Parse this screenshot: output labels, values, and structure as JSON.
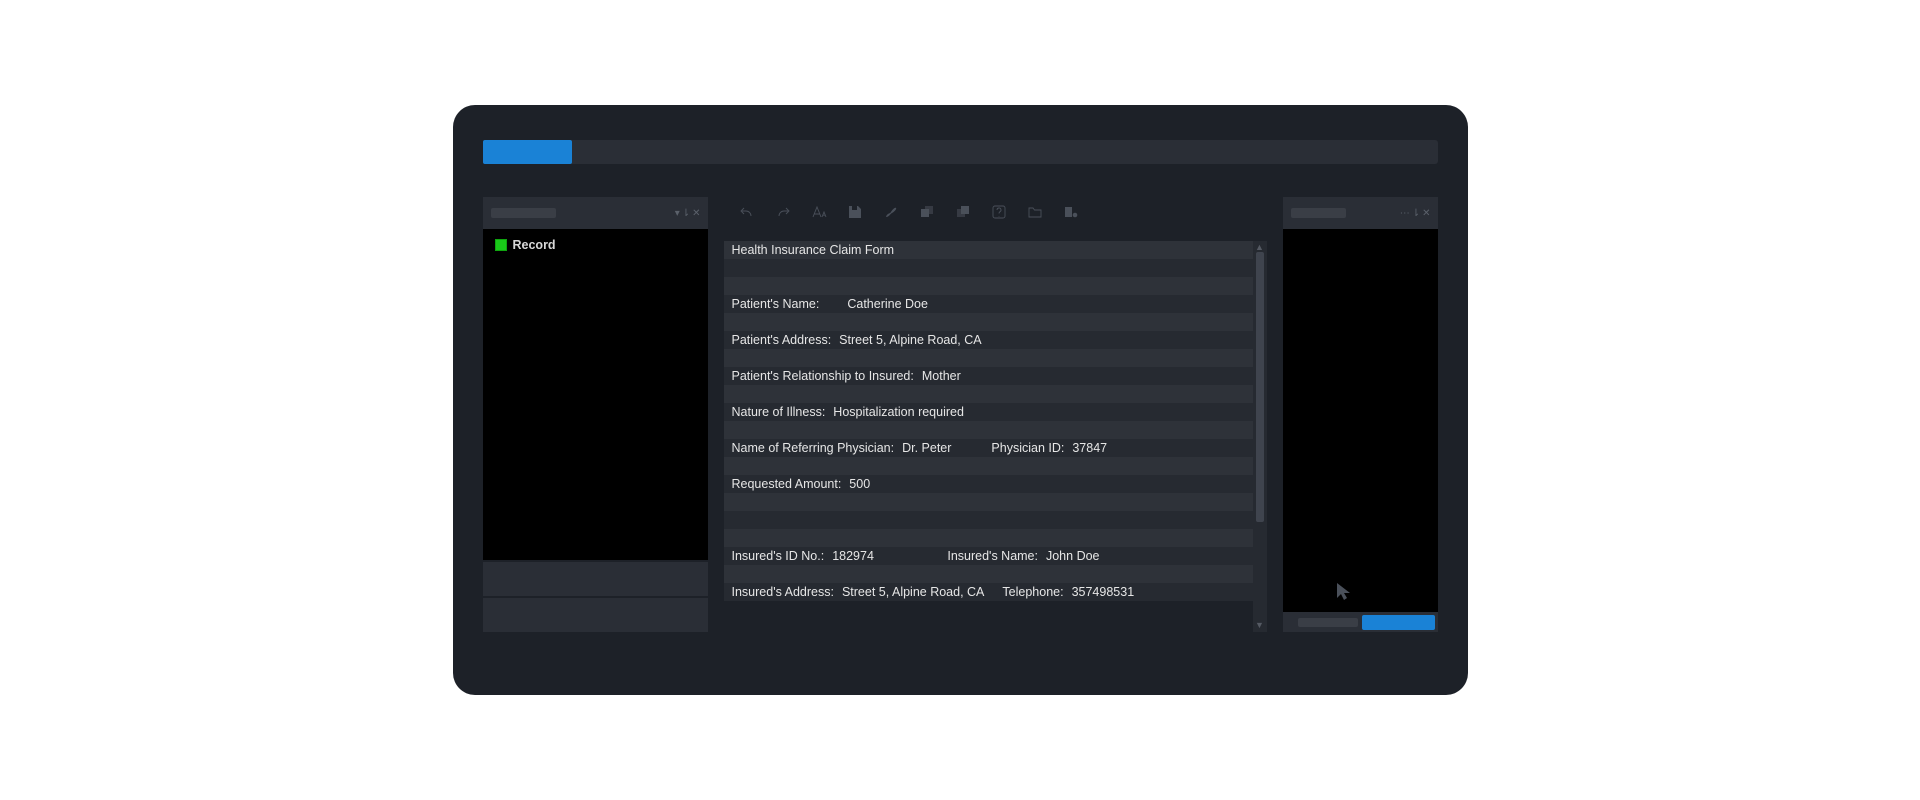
{
  "sidebar": {
    "item_label": "Record"
  },
  "form": {
    "title": "Health Insurance Claim Form",
    "patient_name_label": "Patient's Name:",
    "patient_name": "Catherine Doe",
    "patient_address_label": "Patient's Address:",
    "patient_address": "Street 5, Alpine Road, CA",
    "relationship_label": "Patient's Relationship to Insured:",
    "relationship": "Mother",
    "illness_label": "Nature of Illness:",
    "illness": "Hospitalization required",
    "physician_label": "Name of Referring Physician:",
    "physician": "Dr. Peter",
    "physician_id_label": "Physician ID:",
    "physician_id": "37847",
    "amount_label": "Requested Amount:",
    "amount": "500",
    "insured_id_label": "Insured's ID No.:",
    "insured_id": "182974",
    "insured_name_label": "Insured's Name:",
    "insured_name": "John Doe",
    "insured_address_label": "Insured's Address:",
    "insured_address": "Street 5, Alpine Road, CA",
    "telephone_label": "Telephone:",
    "telephone": "357498531"
  }
}
